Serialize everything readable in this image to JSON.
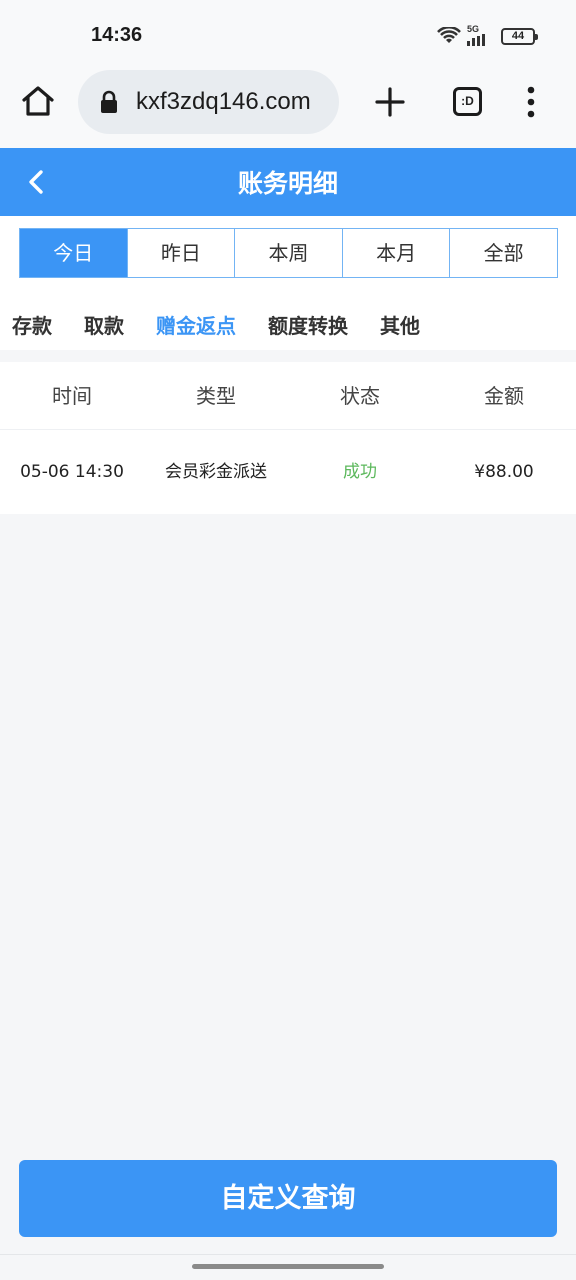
{
  "status_bar": {
    "time": "14:36",
    "network": "5G",
    "battery": "44",
    "icons": [
      "wifi-icon",
      "signal-icon",
      "battery-icon"
    ]
  },
  "browser": {
    "url": "kxf3zdq146.com",
    "tabs_label": ":D",
    "icons": [
      "home-icon",
      "lock-icon",
      "plus-icon",
      "more-icon"
    ]
  },
  "header": {
    "title": "账务明细",
    "accent": "#3b95f5"
  },
  "period_tabs": [
    {
      "label": "今日",
      "active": true
    },
    {
      "label": "昨日",
      "active": false
    },
    {
      "label": "本周",
      "active": false
    },
    {
      "label": "本月",
      "active": false
    },
    {
      "label": "全部",
      "active": false
    }
  ],
  "category_tabs": [
    {
      "label": "存款",
      "active": false
    },
    {
      "label": "取款",
      "active": false
    },
    {
      "label": "赠金返点",
      "active": true
    },
    {
      "label": "额度转换",
      "active": false
    },
    {
      "label": "其他",
      "active": false
    }
  ],
  "table": {
    "columns": [
      "时间",
      "类型",
      "状态",
      "金额"
    ],
    "rows": [
      {
        "time": "05-06 14:30",
        "type": "会员彩金派送",
        "status": "成功",
        "amount": "¥88.00"
      }
    ],
    "success_color": "#5cb85c"
  },
  "footer": {
    "query_label": "自定义查询"
  }
}
